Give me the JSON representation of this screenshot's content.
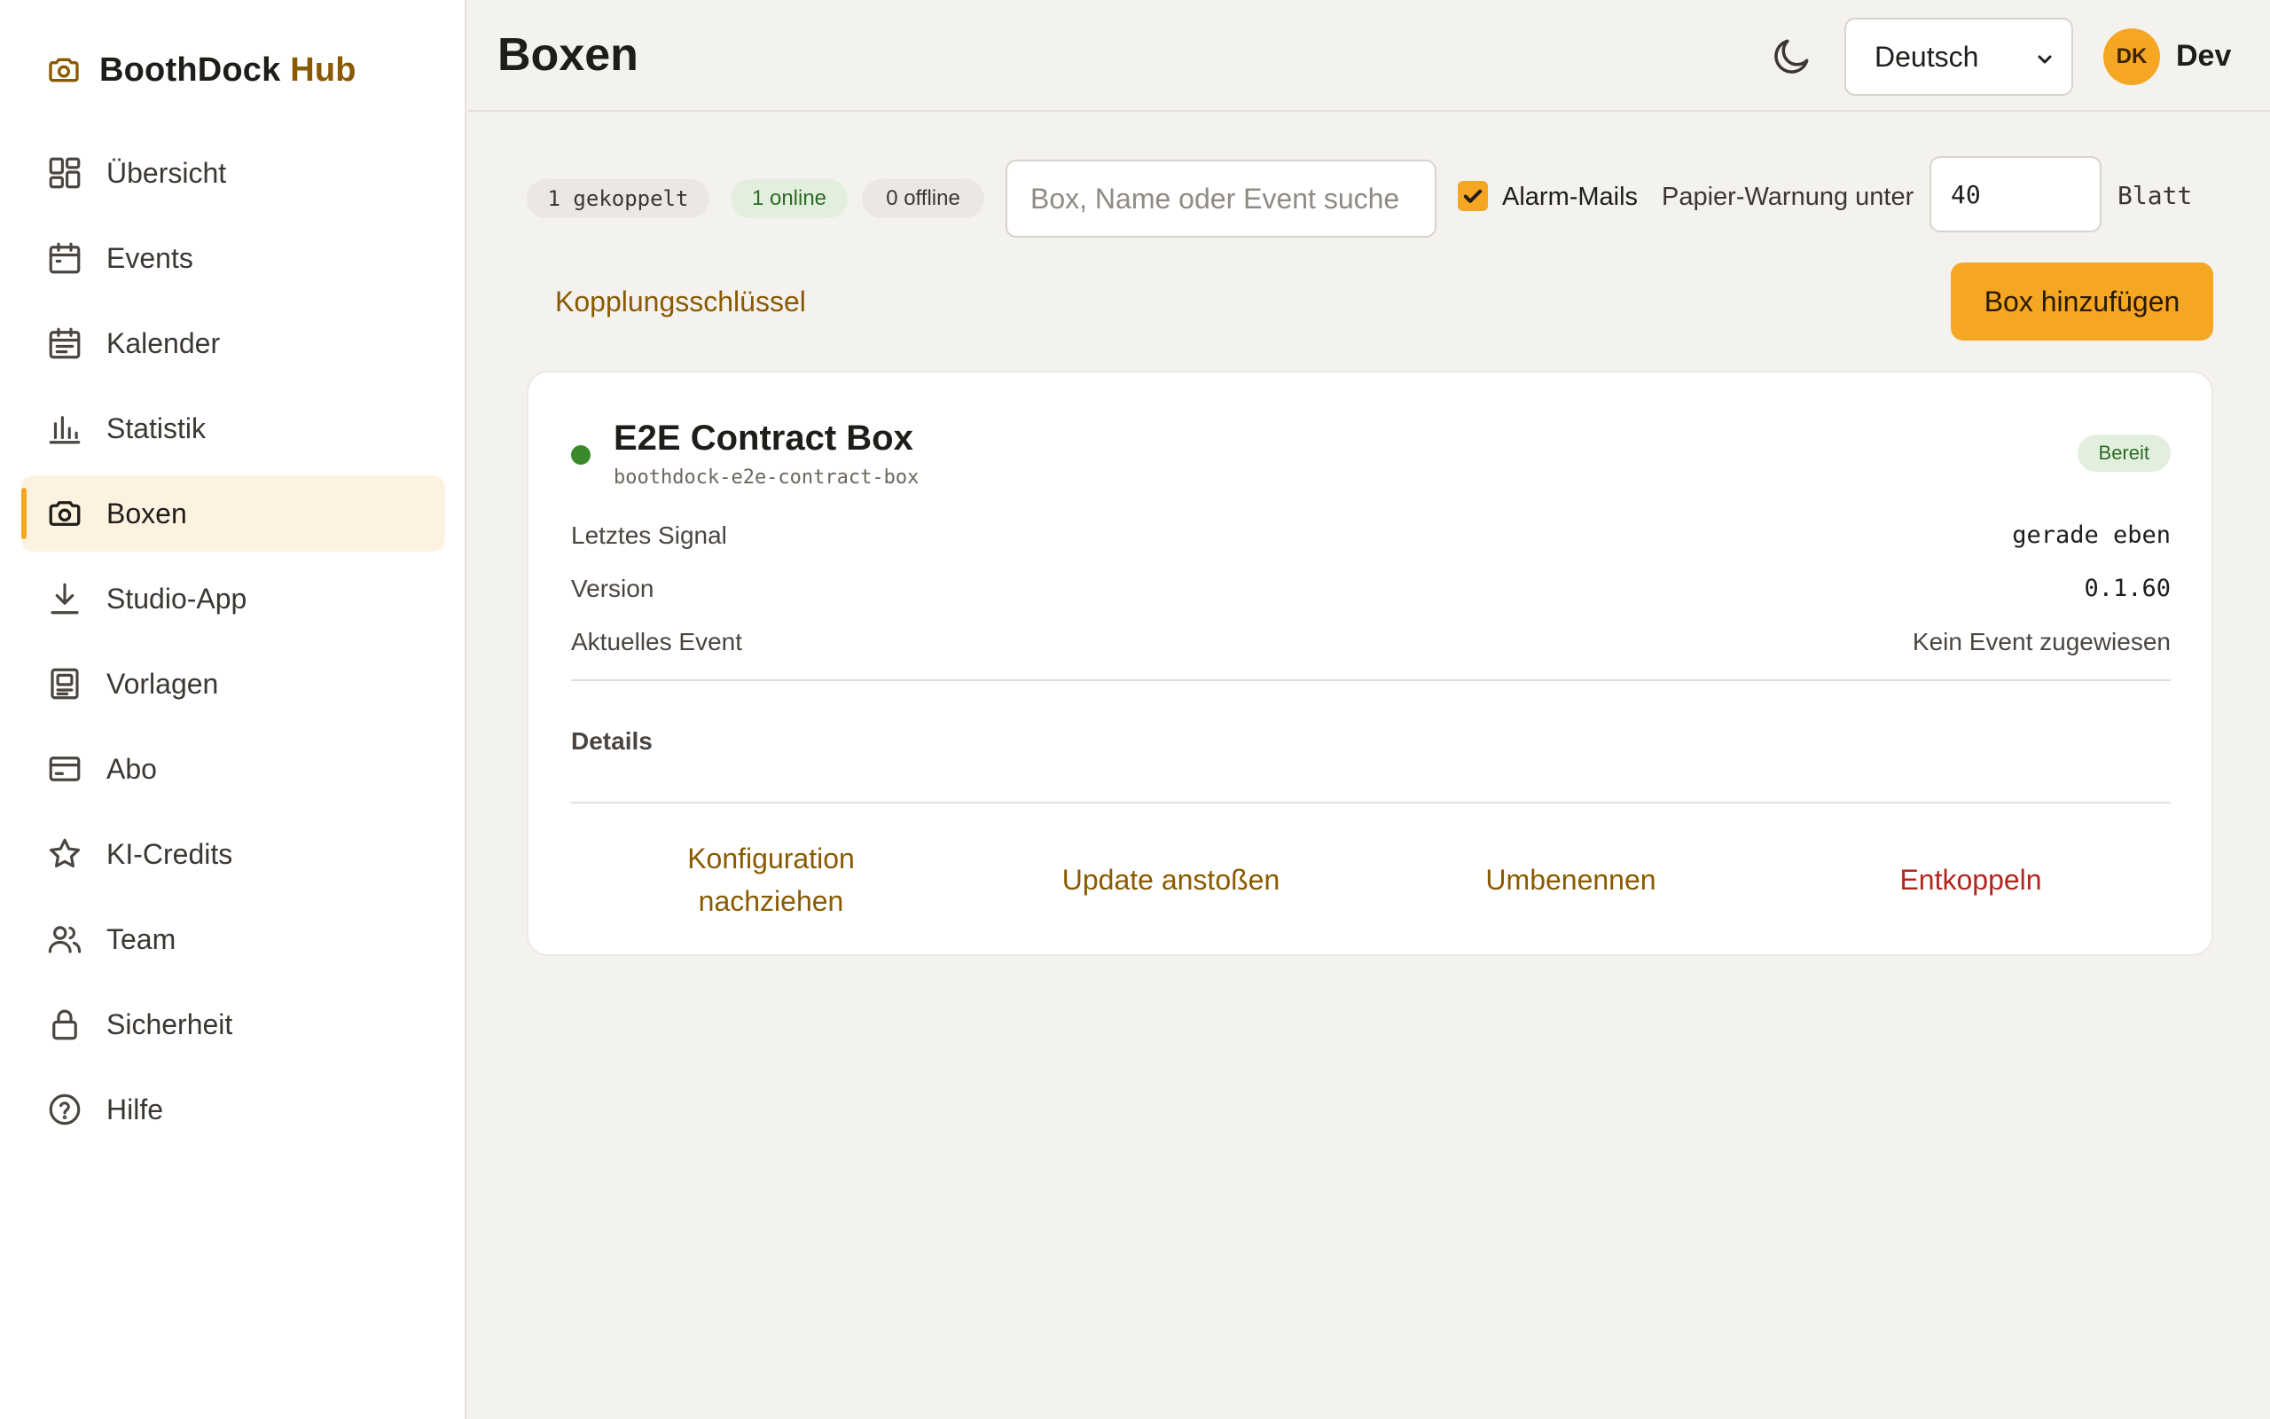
{
  "brand": {
    "name": "BoothDock",
    "accent": "Hub",
    "accent_color": "#8a5a00"
  },
  "sidebar": {
    "items": [
      {
        "label": "Übersicht",
        "icon": "grid-icon"
      },
      {
        "label": "Events",
        "icon": "calendar-icon"
      },
      {
        "label": "Kalender",
        "icon": "calendar-list-icon"
      },
      {
        "label": "Statistik",
        "icon": "bar-chart-icon"
      },
      {
        "label": "Boxen",
        "icon": "camera-icon",
        "active": true
      },
      {
        "label": "Studio-App",
        "icon": "download-icon"
      },
      {
        "label": "Vorlagen",
        "icon": "template-icon"
      },
      {
        "label": "Abo",
        "icon": "credit-card-icon"
      },
      {
        "label": "KI-Credits",
        "icon": "star-icon"
      },
      {
        "label": "Team",
        "icon": "users-icon"
      },
      {
        "label": "Sicherheit",
        "icon": "lock-icon"
      },
      {
        "label": "Hilfe",
        "icon": "help-icon"
      }
    ]
  },
  "header": {
    "title": "Boxen",
    "theme_icon": "moon-icon",
    "language": "Deutsch",
    "user": {
      "initials": "DK",
      "name": "Dev"
    }
  },
  "toolbar": {
    "chips": {
      "paired": "1 gekoppelt",
      "online": "1 online",
      "offline": "0 offline"
    },
    "search_placeholder": "Box, Name oder Event suche",
    "alarm_label": "Alarm-Mails",
    "alarm_checked": true,
    "paper_label": "Papier-Warnung unter",
    "paper_value": "40",
    "paper_unit": "Blatt",
    "pairing_key": "Kopplungsschlüssel",
    "add_box": "Box hinzufügen"
  },
  "box": {
    "name": "E2E Contract Box",
    "slug": "boothdock-e2e-contract-box",
    "status": "Bereit",
    "online": true,
    "rows": {
      "last_signal_label": "Letztes Signal",
      "last_signal_value": "gerade eben",
      "version_label": "Version",
      "version_value": "0.1.60",
      "event_label": "Aktuelles Event",
      "event_value": "Kein Event zugewiesen"
    },
    "details_label": "Details",
    "actions": {
      "sync_config_line1": "Konfiguration",
      "sync_config_line2": "nachziehen",
      "push_update": "Update anstoßen",
      "rename": "Umbenennen",
      "unpair": "Entkoppeln"
    }
  },
  "colors": {
    "accent": "#f5a623",
    "link": "#8a5a00",
    "danger": "#b3261e",
    "online": "#3a8a2a"
  }
}
